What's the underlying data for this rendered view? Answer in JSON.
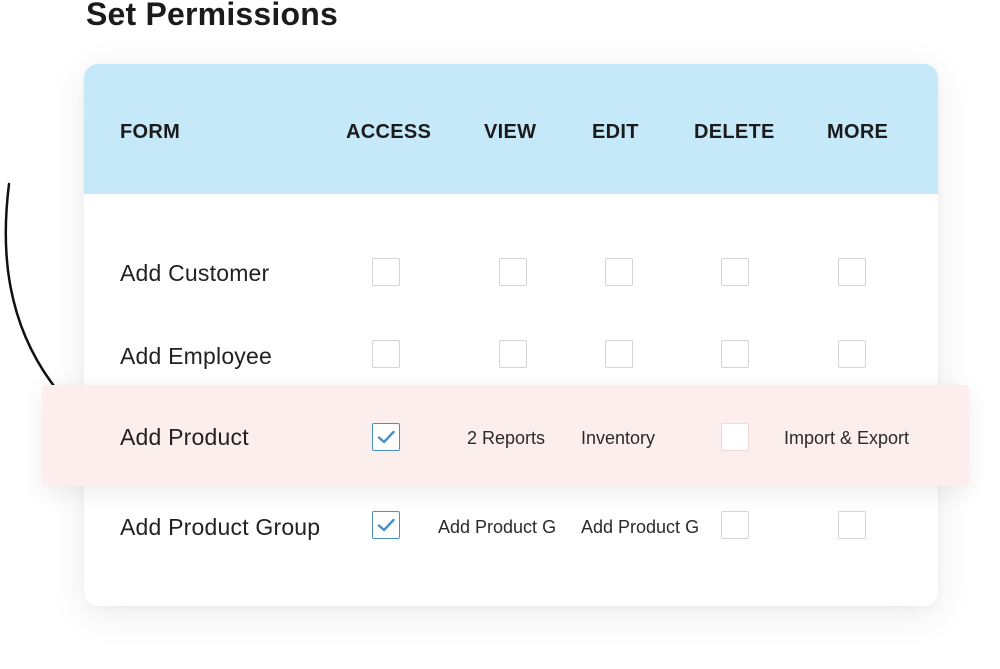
{
  "page": {
    "title": "Set Permissions"
  },
  "table": {
    "headers": {
      "form": "FORM",
      "access": "ACCESS",
      "view": "VIEW",
      "edit": "EDIT",
      "delete": "DELETE",
      "more": "MORE"
    },
    "rows": [
      {
        "label": "Add Customer",
        "access": false,
        "view": false,
        "edit": false,
        "delete": false,
        "more": false
      },
      {
        "label": "Add Employee",
        "access": false,
        "view": false,
        "edit": false,
        "delete": false,
        "more": false
      },
      {
        "label": "Add Product",
        "access": true,
        "view_text": "2 Reports",
        "edit_text": "Inventory",
        "delete": false,
        "more_text": "Import & Export",
        "highlighted": true
      },
      {
        "label": "Add Product Group",
        "access": true,
        "view_text": "Add Product G",
        "edit_text": "Add Product G",
        "delete": false,
        "more": false
      }
    ]
  },
  "colors": {
    "header_bg": "#c6e9f9",
    "highlight_bg": "#fdeeee",
    "check_color": "#4a90c8"
  },
  "icons": {
    "check": "check-icon",
    "arrow": "curved-arrow-icon"
  }
}
